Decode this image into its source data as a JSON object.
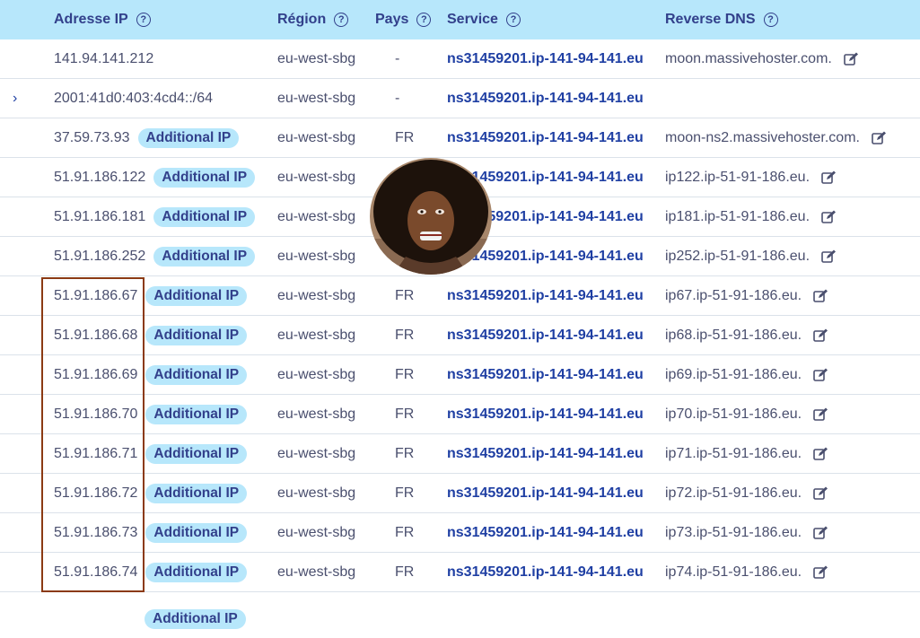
{
  "columns": {
    "ip": "Adresse IP",
    "region": "Région",
    "country": "Pays",
    "service": "Service",
    "reverse": "Reverse DNS"
  },
  "help_glyph": "?",
  "expand_glyph": "›",
  "rows": [
    {
      "ip": "141.94.141.212",
      "badge": "",
      "region": "eu-west-sbg",
      "country": "-",
      "service": "ns31459201.ip-141-94-141.eu",
      "reverse": "moon.massivehoster.com."
    },
    {
      "ip": "2001:41d0:403:4cd4::/64",
      "badge": "",
      "region": "eu-west-sbg",
      "country": "-",
      "service": "ns31459201.ip-141-94-141.eu",
      "reverse": ""
    },
    {
      "ip": "37.59.73.93",
      "badge": "Additional IP",
      "region": "eu-west-sbg",
      "country": "FR",
      "service": "ns31459201.ip-141-94-141.eu",
      "reverse": "moon-ns2.massivehoster.com."
    },
    {
      "ip": "51.91.186.122",
      "badge": "Additional IP",
      "region": "eu-west-sbg",
      "country": "",
      "service": "ns31459201.ip-141-94-141.eu",
      "reverse": "ip122.ip-51-91-186.eu."
    },
    {
      "ip": "51.91.186.181",
      "badge": "Additional IP",
      "region": "eu-west-sbg",
      "country": "",
      "service": "ns31459201.ip-141-94-141.eu",
      "reverse": "ip181.ip-51-91-186.eu."
    },
    {
      "ip": "51.91.186.252",
      "badge": "Additional IP",
      "region": "eu-west-sbg",
      "country": "",
      "service": "ns31459201.ip-141-94-141.eu",
      "reverse": "ip252.ip-51-91-186.eu."
    },
    {
      "ip": "51.91.186.67",
      "badge": "Additional IP",
      "region": "eu-west-sbg",
      "country": "FR",
      "service": "ns31459201.ip-141-94-141.eu",
      "reverse": "ip67.ip-51-91-186.eu."
    },
    {
      "ip": "51.91.186.68",
      "badge": "Additional IP",
      "region": "eu-west-sbg",
      "country": "FR",
      "service": "ns31459201.ip-141-94-141.eu",
      "reverse": "ip68.ip-51-91-186.eu."
    },
    {
      "ip": "51.91.186.69",
      "badge": "Additional IP",
      "region": "eu-west-sbg",
      "country": "FR",
      "service": "ns31459201.ip-141-94-141.eu",
      "reverse": "ip69.ip-51-91-186.eu."
    },
    {
      "ip": "51.91.186.70",
      "badge": "Additional IP",
      "region": "eu-west-sbg",
      "country": "FR",
      "service": "ns31459201.ip-141-94-141.eu",
      "reverse": "ip70.ip-51-91-186.eu."
    },
    {
      "ip": "51.91.186.71",
      "badge": "Additional IP",
      "region": "eu-west-sbg",
      "country": "FR",
      "service": "ns31459201.ip-141-94-141.eu",
      "reverse": "ip71.ip-51-91-186.eu."
    },
    {
      "ip": "51.91.186.72",
      "badge": "Additional IP",
      "region": "eu-west-sbg",
      "country": "FR",
      "service": "ns31459201.ip-141-94-141.eu",
      "reverse": "ip72.ip-51-91-186.eu."
    },
    {
      "ip": "51.91.186.73",
      "badge": "Additional IP",
      "region": "eu-west-sbg",
      "country": "FR",
      "service": "ns31459201.ip-141-94-141.eu",
      "reverse": "ip73.ip-51-91-186.eu."
    },
    {
      "ip": "51.91.186.74",
      "badge": "Additional IP",
      "region": "eu-west-sbg",
      "country": "FR",
      "service": "ns31459201.ip-141-94-141.eu",
      "reverse": "ip74.ip-51-91-186.eu."
    }
  ],
  "partial_badge": "Additional IP",
  "colors": {
    "header_bg": "#b7e7fb",
    "badge_bg": "#b7e7fb",
    "link": "#1f3fa3",
    "highlight_border": "#8b3a14"
  }
}
